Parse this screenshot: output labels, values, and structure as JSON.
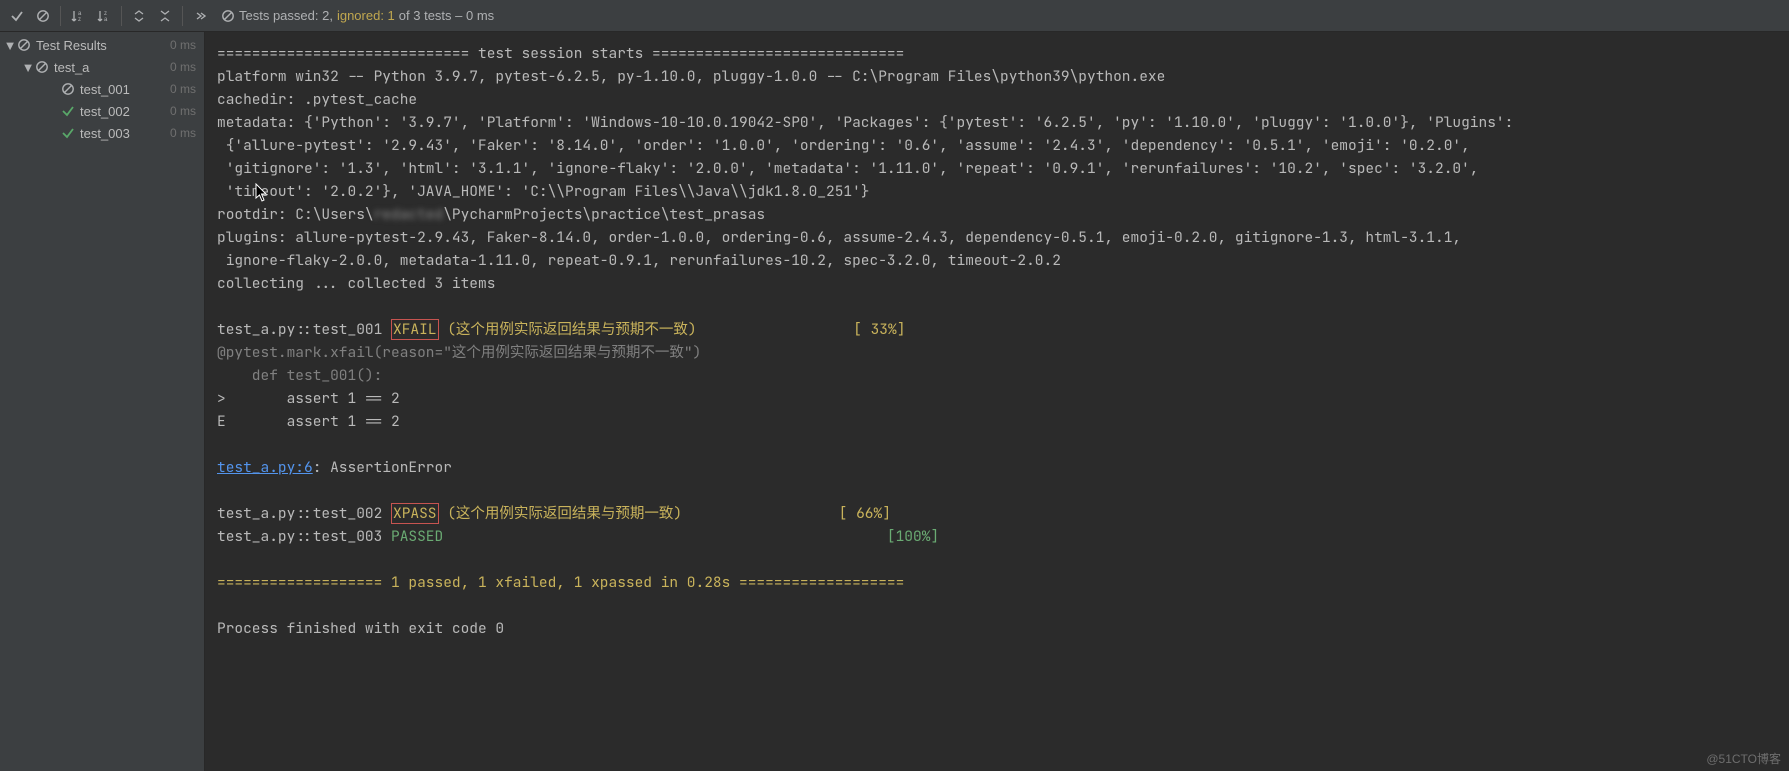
{
  "toolbar": {
    "status_prefix": "Tests passed: 2,",
    "status_ignored": " ignored: 1",
    "status_suffix": " of 3 tests – 0 ms"
  },
  "tree": {
    "root": {
      "label": "Test Results",
      "time": "0 ms"
    },
    "suite": {
      "label": "test_a",
      "time": "0 ms"
    },
    "tests": [
      {
        "label": "test_001",
        "time": "0 ms",
        "status": "skip"
      },
      {
        "label": "test_002",
        "time": "0 ms",
        "status": "pass"
      },
      {
        "label": "test_003",
        "time": "0 ms",
        "status": "pass"
      }
    ]
  },
  "console": {
    "l1": "============================= test session starts =============================",
    "l2": "platform win32 -- Python 3.9.7, pytest-6.2.5, py-1.10.0, pluggy-1.0.0 -- C:\\Program Files\\python39\\python.exe",
    "l3": "cachedir: .pytest_cache",
    "l4": "metadata: {'Python': '3.9.7', 'Platform': 'Windows-10-10.0.19042-SP0', 'Packages': {'pytest': '6.2.5', 'py': '1.10.0', 'pluggy': '1.0.0'}, 'Plugins':",
    "l5": " {'allure-pytest': '2.9.43', 'Faker': '8.14.0', 'order': '1.0.0', 'ordering': '0.6', 'assume': '2.4.3', 'dependency': '0.5.1', 'emoji': '0.2.0',",
    "l6": " 'gitignore': '1.3', 'html': '3.1.1', 'ignore-flaky': '2.0.0', 'metadata': '1.11.0', 'repeat': '0.9.1', 'rerunfailures': '10.2', 'spec': '3.2.0',",
    "l7": " 'timeout': '2.0.2'}, 'JAVA_HOME': 'C:\\\\Program Files\\\\Java\\\\jdk1.8.0_251'}",
    "l8a": "rootdir: C:\\Users\\",
    "l8b": "redacted",
    "l8c": "\\PycharmProjects\\practice\\test_prasas",
    "l9": "plugins: allure-pytest-2.9.43, Faker-8.14.0, order-1.0.0, ordering-0.6, assume-2.4.3, dependency-0.5.1, emoji-0.2.0, gitignore-1.3, html-3.1.1,",
    "l10": " ignore-flaky-2.0.0, metadata-1.11.0, repeat-0.9.1, rerunfailures-10.2, spec-3.2.0, timeout-2.0.2",
    "l11": "collecting ... collected 3 items",
    "l13a": "test_a.py::test_001 ",
    "l13b": "XFAIL",
    "l13c": " (这个用例实际返回结果与预期不一致)                  [ 33%]",
    "l14": "@pytest.mark.xfail(reason=\"这个用例实际返回结果与预期不一致\")",
    "l15": "    def test_001():",
    "l16": ">       assert 1 == 2",
    "l17": "E       assert 1 == 2",
    "l19a": "test_a.py:6",
    "l19b": ": AssertionError",
    "l21a": "test_a.py::test_002 ",
    "l21b": "XPASS",
    "l21c": " (这个用例实际返回结果与预期一致)                  [ 66%]",
    "l22a": "test_a.py::test_003 ",
    "l22b": "PASSED",
    "l22c": "                                                   [100%]",
    "l24": "=================== 1 passed, 1 xfailed, 1 xpassed in 0.28s ===================",
    "l26": "Process finished with exit code 0"
  },
  "watermark": "@51CTO博客"
}
